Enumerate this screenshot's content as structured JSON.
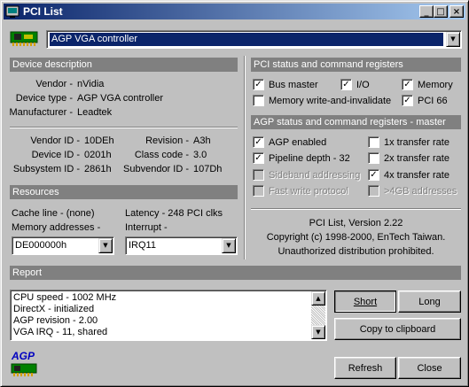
{
  "window": {
    "title": "PCI List"
  },
  "device_select": {
    "value": "AGP VGA controller"
  },
  "device_description": {
    "header": "Device description",
    "vendor_label": "Vendor -",
    "vendor_value": "nVidia",
    "device_type_label": "Device type -",
    "device_type_value": "AGP VGA controller",
    "manufacturer_label": "Manufacturer -",
    "manufacturer_value": "Leadtek",
    "vendor_id_label": "Vendor ID -",
    "vendor_id_value": "10DEh",
    "device_id_label": "Device ID -",
    "device_id_value": "0201h",
    "subsystem_id_label": "Subsystem ID -",
    "subsystem_id_value": "2861h",
    "revision_label": "Revision -",
    "revision_value": "A3h",
    "class_code_label": "Class code -",
    "class_code_value": "3.0",
    "subvendor_id_label": "Subvendor ID -",
    "subvendor_id_value": "107Dh"
  },
  "resources": {
    "header": "Resources",
    "cache_line": "Cache line - (none)",
    "latency": "Latency - 248 PCI clks",
    "memory_label": "Memory addresses -",
    "memory_value": "DE000000h",
    "interrupt_label": "Interrupt -",
    "interrupt_value": "IRQ11"
  },
  "pci_status": {
    "header": "PCI status and command registers",
    "bus_master": {
      "label": "Bus master",
      "checked": true
    },
    "io": {
      "label": "I/O",
      "checked": true
    },
    "memory": {
      "label": "Memory",
      "checked": true
    },
    "mwi": {
      "label": "Memory write-and-invalidate",
      "checked": false
    },
    "pci66": {
      "label": "PCI 66",
      "checked": true
    }
  },
  "agp_status": {
    "header": "AGP status and command registers - master",
    "agp_enabled": {
      "label": "AGP enabled",
      "checked": true
    },
    "rate_1x": {
      "label": "1x transfer rate",
      "checked": false
    },
    "pipeline_depth": {
      "label": "Pipeline depth - 32",
      "checked": true
    },
    "rate_2x": {
      "label": "2x transfer rate",
      "checked": false
    },
    "sideband": {
      "label": "Sideband addressing",
      "checked": false
    },
    "rate_4x": {
      "label": "4x transfer rate",
      "checked": true
    },
    "fast_write": {
      "label": "Fast write protocol",
      "checked": false
    },
    "gt4gb": {
      "label": ">4GB addresses",
      "checked": false
    }
  },
  "about": {
    "line1": "PCI List, Version 2.22",
    "line2": "Copyright (c) 1998-2000, EnTech Taiwan.",
    "line3": "Unauthorized distribution prohibited."
  },
  "report": {
    "header": "Report",
    "lines": [
      "CPU speed - 1002 MHz",
      "DirectX - initialized",
      "AGP revision - 2.00",
      "VGA IRQ - 11, shared"
    ],
    "short_label": "Short",
    "long_label": "Long",
    "copy_label": "Copy to clipboard"
  },
  "footer": {
    "logo_text": "AGP",
    "refresh_label": "Refresh",
    "close_label": "Close"
  },
  "colors": {
    "title_start": "#0a246a",
    "title_end": "#a6caf0",
    "section_header": "#808080",
    "face": "#c0c0c0"
  }
}
